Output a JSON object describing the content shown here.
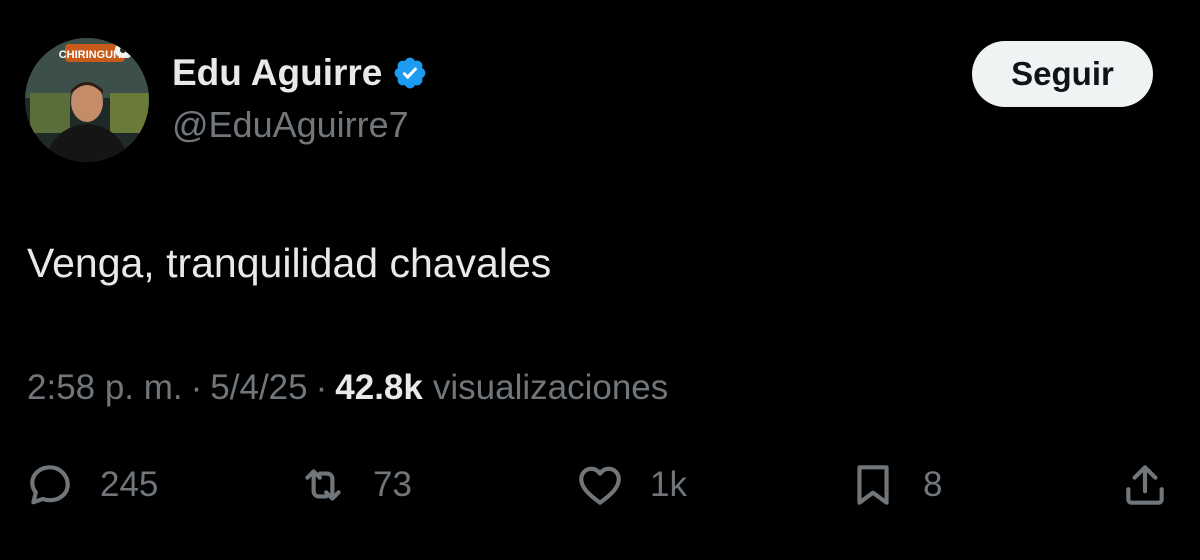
{
  "user": {
    "display_name": "Edu Aguirre",
    "handle": "@EduAguirre7",
    "verified_icon": "verified-badge-icon",
    "verified_color": "#1d9bf0",
    "avatar_sign_text": "CHIRINGUITO"
  },
  "follow_button": {
    "label": "Seguir"
  },
  "tweet": {
    "text": "Venga, tranquilidad chavales"
  },
  "meta": {
    "time": "2:58 p. m.",
    "separator": "·",
    "date": "5/4/25",
    "views_count": "42.8k",
    "views_label": "visualizaciones"
  },
  "actions": {
    "replies": {
      "icon": "reply-icon",
      "count": "245"
    },
    "retweets": {
      "icon": "retweet-icon",
      "count": "73"
    },
    "likes": {
      "icon": "heart-icon",
      "count": "1k"
    },
    "bookmarks": {
      "icon": "bookmark-icon",
      "count": "8"
    },
    "share": {
      "icon": "share-icon"
    }
  },
  "colors": {
    "background": "#000000",
    "primary_text": "#e7e9ea",
    "secondary_text": "#71767b",
    "button_bg": "#eff3f4"
  }
}
